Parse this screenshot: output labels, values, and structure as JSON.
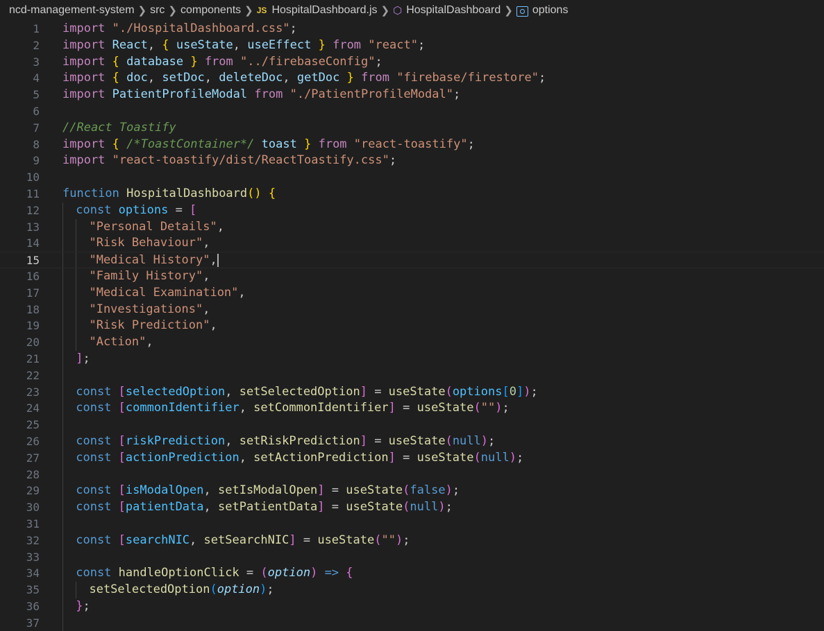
{
  "breadcrumb": {
    "project": "ncd-management-system",
    "folder1": "src",
    "folder2": "components",
    "file_badge": "JS",
    "file": "HospitalDashboard.js",
    "component": "HospitalDashboard",
    "symbol": "options"
  },
  "editor": {
    "current_line": 15,
    "lines": [
      {
        "n": "1",
        "indent": 0,
        "tokens": [
          [
            "kw",
            "import"
          ],
          [
            "txt",
            " "
          ],
          [
            "str",
            "\"./HospitalDashboard.css\""
          ],
          [
            "txt",
            ";"
          ]
        ]
      },
      {
        "n": "2",
        "indent": 0,
        "tokens": [
          [
            "kw",
            "import"
          ],
          [
            "txt",
            " "
          ],
          [
            "var",
            "React"
          ],
          [
            "txt",
            ", "
          ],
          [
            "b1",
            "{"
          ],
          [
            "txt",
            " "
          ],
          [
            "var",
            "useState"
          ],
          [
            "txt",
            ", "
          ],
          [
            "var",
            "useEffect"
          ],
          [
            "txt",
            " "
          ],
          [
            "b1",
            "}"
          ],
          [
            "txt",
            " "
          ],
          [
            "kw",
            "from"
          ],
          [
            "txt",
            " "
          ],
          [
            "str",
            "\"react\""
          ],
          [
            "txt",
            ";"
          ]
        ]
      },
      {
        "n": "3",
        "indent": 0,
        "tokens": [
          [
            "kw",
            "import"
          ],
          [
            "txt",
            " "
          ],
          [
            "b1",
            "{"
          ],
          [
            "txt",
            " "
          ],
          [
            "var",
            "database"
          ],
          [
            "txt",
            " "
          ],
          [
            "b1",
            "}"
          ],
          [
            "txt",
            " "
          ],
          [
            "kw",
            "from"
          ],
          [
            "txt",
            " "
          ],
          [
            "str",
            "\"../firebaseConfig\""
          ],
          [
            "txt",
            ";"
          ]
        ]
      },
      {
        "n": "4",
        "indent": 0,
        "tokens": [
          [
            "kw",
            "import"
          ],
          [
            "txt",
            " "
          ],
          [
            "b1",
            "{"
          ],
          [
            "txt",
            " "
          ],
          [
            "var",
            "doc"
          ],
          [
            "txt",
            ", "
          ],
          [
            "var",
            "setDoc"
          ],
          [
            "txt",
            ", "
          ],
          [
            "var",
            "deleteDoc"
          ],
          [
            "txt",
            ", "
          ],
          [
            "var",
            "getDoc"
          ],
          [
            "txt",
            " "
          ],
          [
            "b1",
            "}"
          ],
          [
            "txt",
            " "
          ],
          [
            "kw",
            "from"
          ],
          [
            "txt",
            " "
          ],
          [
            "str",
            "\"firebase/firestore\""
          ],
          [
            "txt",
            ";"
          ]
        ]
      },
      {
        "n": "5",
        "indent": 0,
        "tokens": [
          [
            "kw",
            "import"
          ],
          [
            "txt",
            " "
          ],
          [
            "var",
            "PatientProfileModal"
          ],
          [
            "txt",
            " "
          ],
          [
            "kw",
            "from"
          ],
          [
            "txt",
            " "
          ],
          [
            "str",
            "\"./PatientProfileModal\""
          ],
          [
            "txt",
            ";"
          ]
        ]
      },
      {
        "n": "6",
        "indent": 0,
        "tokens": []
      },
      {
        "n": "7",
        "indent": 0,
        "tokens": [
          [
            "cmt",
            "//React Toastify"
          ]
        ]
      },
      {
        "n": "8",
        "indent": 0,
        "tokens": [
          [
            "kw",
            "import"
          ],
          [
            "txt",
            " "
          ],
          [
            "b1",
            "{"
          ],
          [
            "txt",
            " "
          ],
          [
            "cmt",
            "/*ToastContainer*/"
          ],
          [
            "txt",
            " "
          ],
          [
            "var",
            "toast"
          ],
          [
            "txt",
            " "
          ],
          [
            "b1",
            "}"
          ],
          [
            "txt",
            " "
          ],
          [
            "kw",
            "from"
          ],
          [
            "txt",
            " "
          ],
          [
            "str",
            "\"react-toastify\""
          ],
          [
            "txt",
            ";"
          ]
        ]
      },
      {
        "n": "9",
        "indent": 0,
        "tokens": [
          [
            "kw",
            "import"
          ],
          [
            "txt",
            " "
          ],
          [
            "str",
            "\"react-toastify/dist/ReactToastify.css\""
          ],
          [
            "txt",
            ";"
          ]
        ]
      },
      {
        "n": "10",
        "indent": 0,
        "tokens": []
      },
      {
        "n": "11",
        "indent": 0,
        "tokens": [
          [
            "kwb",
            "function"
          ],
          [
            "txt",
            " "
          ],
          [
            "fn",
            "HospitalDashboard"
          ],
          [
            "b1",
            "()"
          ],
          [
            "txt",
            " "
          ],
          [
            "b1",
            "{"
          ]
        ]
      },
      {
        "n": "12",
        "indent": 1,
        "tokens": [
          [
            "kwb",
            "const"
          ],
          [
            "txt",
            " "
          ],
          [
            "cvar",
            "options"
          ],
          [
            "txt",
            " = "
          ],
          [
            "b2",
            "["
          ]
        ]
      },
      {
        "n": "13",
        "indent": 2,
        "tokens": [
          [
            "str",
            "\"Personal Details\""
          ],
          [
            "txt",
            ","
          ]
        ]
      },
      {
        "n": "14",
        "indent": 2,
        "tokens": [
          [
            "str",
            "\"Risk Behaviour\""
          ],
          [
            "txt",
            ","
          ]
        ]
      },
      {
        "n": "15",
        "indent": 2,
        "tokens": [
          [
            "str",
            "\"Medical History\""
          ],
          [
            "txt",
            ","
          ]
        ]
      },
      {
        "n": "16",
        "indent": 2,
        "tokens": [
          [
            "str",
            "\"Family History\""
          ],
          [
            "txt",
            ","
          ]
        ]
      },
      {
        "n": "17",
        "indent": 2,
        "tokens": [
          [
            "str",
            "\"Medical Examination\""
          ],
          [
            "txt",
            ","
          ]
        ]
      },
      {
        "n": "18",
        "indent": 2,
        "tokens": [
          [
            "str",
            "\"Investigations\""
          ],
          [
            "txt",
            ","
          ]
        ]
      },
      {
        "n": "19",
        "indent": 2,
        "tokens": [
          [
            "str",
            "\"Risk Prediction\""
          ],
          [
            "txt",
            ","
          ]
        ]
      },
      {
        "n": "20",
        "indent": 2,
        "tokens": [
          [
            "str",
            "\"Action\""
          ],
          [
            "txt",
            ","
          ]
        ]
      },
      {
        "n": "21",
        "indent": 1,
        "tokens": [
          [
            "b2",
            "]"
          ],
          [
            "txt",
            ";"
          ]
        ]
      },
      {
        "n": "22",
        "indent": 1,
        "tokens": []
      },
      {
        "n": "23",
        "indent": 1,
        "tokens": [
          [
            "kwb",
            "const"
          ],
          [
            "txt",
            " "
          ],
          [
            "b2",
            "["
          ],
          [
            "cvar",
            "selectedOption"
          ],
          [
            "txt",
            ", "
          ],
          [
            "fn",
            "setSelectedOption"
          ],
          [
            "b2",
            "]"
          ],
          [
            "txt",
            " = "
          ],
          [
            "fn",
            "useState"
          ],
          [
            "b2",
            "("
          ],
          [
            "cvar",
            "options"
          ],
          [
            "b3",
            "["
          ],
          [
            "num",
            "0"
          ],
          [
            "b3",
            "]"
          ],
          [
            "b2",
            ")"
          ],
          [
            "txt",
            ";"
          ]
        ]
      },
      {
        "n": "24",
        "indent": 1,
        "tokens": [
          [
            "kwb",
            "const"
          ],
          [
            "txt",
            " "
          ],
          [
            "b2",
            "["
          ],
          [
            "cvar",
            "commonIdentifier"
          ],
          [
            "txt",
            ", "
          ],
          [
            "fn",
            "setCommonIdentifier"
          ],
          [
            "b2",
            "]"
          ],
          [
            "txt",
            " = "
          ],
          [
            "fn",
            "useState"
          ],
          [
            "b2",
            "("
          ],
          [
            "str",
            "\"\""
          ],
          [
            "b2",
            ")"
          ],
          [
            "txt",
            ";"
          ]
        ]
      },
      {
        "n": "25",
        "indent": 1,
        "tokens": []
      },
      {
        "n": "26",
        "indent": 1,
        "tokens": [
          [
            "kwb",
            "const"
          ],
          [
            "txt",
            " "
          ],
          [
            "b2",
            "["
          ],
          [
            "cvar",
            "riskPrediction"
          ],
          [
            "txt",
            ", "
          ],
          [
            "fn",
            "setRiskPrediction"
          ],
          [
            "b2",
            "]"
          ],
          [
            "txt",
            " = "
          ],
          [
            "fn",
            "useState"
          ],
          [
            "b2",
            "("
          ],
          [
            "kwb",
            "null"
          ],
          [
            "b2",
            ")"
          ],
          [
            "txt",
            ";"
          ]
        ]
      },
      {
        "n": "27",
        "indent": 1,
        "tokens": [
          [
            "kwb",
            "const"
          ],
          [
            "txt",
            " "
          ],
          [
            "b2",
            "["
          ],
          [
            "cvar",
            "actionPrediction"
          ],
          [
            "txt",
            ", "
          ],
          [
            "fn",
            "setActionPrediction"
          ],
          [
            "b2",
            "]"
          ],
          [
            "txt",
            " = "
          ],
          [
            "fn",
            "useState"
          ],
          [
            "b2",
            "("
          ],
          [
            "kwb",
            "null"
          ],
          [
            "b2",
            ")"
          ],
          [
            "txt",
            ";"
          ]
        ]
      },
      {
        "n": "28",
        "indent": 1,
        "tokens": []
      },
      {
        "n": "29",
        "indent": 1,
        "tokens": [
          [
            "kwb",
            "const"
          ],
          [
            "txt",
            " "
          ],
          [
            "b2",
            "["
          ],
          [
            "cvar",
            "isModalOpen"
          ],
          [
            "txt",
            ", "
          ],
          [
            "fn",
            "setIsModalOpen"
          ],
          [
            "b2",
            "]"
          ],
          [
            "txt",
            " = "
          ],
          [
            "fn",
            "useState"
          ],
          [
            "b2",
            "("
          ],
          [
            "kwb",
            "false"
          ],
          [
            "b2",
            ")"
          ],
          [
            "txt",
            ";"
          ]
        ]
      },
      {
        "n": "30",
        "indent": 1,
        "tokens": [
          [
            "kwb",
            "const"
          ],
          [
            "txt",
            " "
          ],
          [
            "b2",
            "["
          ],
          [
            "cvar",
            "patientData"
          ],
          [
            "txt",
            ", "
          ],
          [
            "fn",
            "setPatientData"
          ],
          [
            "b2",
            "]"
          ],
          [
            "txt",
            " = "
          ],
          [
            "fn",
            "useState"
          ],
          [
            "b2",
            "("
          ],
          [
            "kwb",
            "null"
          ],
          [
            "b2",
            ")"
          ],
          [
            "txt",
            ";"
          ]
        ]
      },
      {
        "n": "31",
        "indent": 1,
        "tokens": []
      },
      {
        "n": "32",
        "indent": 1,
        "tokens": [
          [
            "kwb",
            "const"
          ],
          [
            "txt",
            " "
          ],
          [
            "b2",
            "["
          ],
          [
            "cvar",
            "searchNIC"
          ],
          [
            "txt",
            ", "
          ],
          [
            "fn",
            "setSearchNIC"
          ],
          [
            "b2",
            "]"
          ],
          [
            "txt",
            " = "
          ],
          [
            "fn",
            "useState"
          ],
          [
            "b2",
            "("
          ],
          [
            "str",
            "\"\""
          ],
          [
            "b2",
            ")"
          ],
          [
            "txt",
            ";"
          ]
        ]
      },
      {
        "n": "33",
        "indent": 1,
        "tokens": []
      },
      {
        "n": "34",
        "indent": 1,
        "tokens": [
          [
            "kwb",
            "const"
          ],
          [
            "txt",
            " "
          ],
          [
            "fn",
            "handleOptionClick"
          ],
          [
            "txt",
            " = "
          ],
          [
            "b2",
            "("
          ],
          [
            "param",
            "option"
          ],
          [
            "b2",
            ")"
          ],
          [
            "txt",
            " "
          ],
          [
            "kwb",
            "=>"
          ],
          [
            "txt",
            " "
          ],
          [
            "b2",
            "{"
          ]
        ]
      },
      {
        "n": "35",
        "indent": 2,
        "tokens": [
          [
            "fn",
            "setSelectedOption"
          ],
          [
            "b3",
            "("
          ],
          [
            "param",
            "option"
          ],
          [
            "b3",
            ")"
          ],
          [
            "txt",
            ";"
          ]
        ]
      },
      {
        "n": "36",
        "indent": 1,
        "tokens": [
          [
            "b2",
            "}"
          ],
          [
            "txt",
            ";"
          ]
        ]
      },
      {
        "n": "37",
        "indent": 1,
        "tokens": []
      }
    ]
  }
}
